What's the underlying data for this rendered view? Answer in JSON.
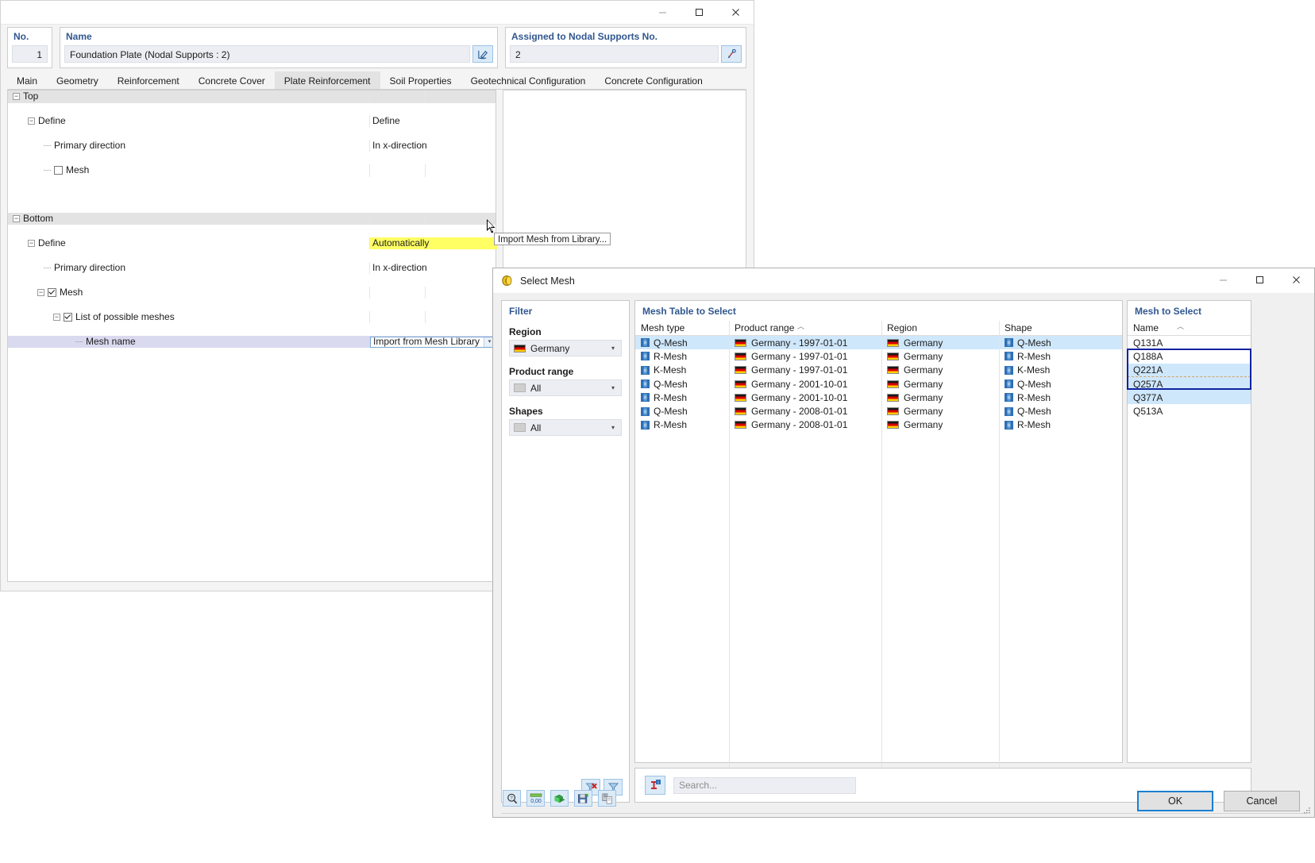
{
  "main_window": {
    "title_controls": [
      "minimize",
      "maximize",
      "close"
    ],
    "fields": {
      "no_label": "No.",
      "no_value": "1",
      "name_label": "Name",
      "name_value": "Foundation Plate (Nodal Supports : 2)",
      "name_edit_icon": "edit-pencil-icon",
      "assigned_label": "Assigned to Nodal Supports No.",
      "assigned_value": "2",
      "assigned_pick_icon": "pick-object-icon"
    },
    "tabs": [
      {
        "label": "Main",
        "active": false
      },
      {
        "label": "Geometry",
        "active": false
      },
      {
        "label": "Reinforcement",
        "active": false
      },
      {
        "label": "Concrete Cover",
        "active": false
      },
      {
        "label": "Plate Reinforcement",
        "active": true
      },
      {
        "label": "Soil Properties",
        "active": false
      },
      {
        "label": "Geotechnical Configuration",
        "active": false
      },
      {
        "label": "Concrete Configuration",
        "active": false
      }
    ],
    "tree": {
      "top_group": "Top",
      "top_define_label": "Define",
      "top_define_value": "Define",
      "top_primary_label": "Primary direction",
      "top_primary_value": "In x-direction",
      "top_mesh_label": "Mesh",
      "bottom_group": "Bottom",
      "bottom_define_label": "Define",
      "bottom_define_value": "Automatically",
      "bottom_primary_label": "Primary direction",
      "bottom_primary_value": "In x-direction",
      "bottom_mesh_label": "Mesh",
      "list_meshes_label": "List of possible meshes",
      "mesh_name_label": "Mesh name",
      "mesh_name_value": "Import from Mesh Library"
    },
    "tooltip": "Import Mesh from Library..."
  },
  "dialog": {
    "title": "Select Mesh",
    "icon": "mesh-library-icon",
    "title_controls": [
      "minimize",
      "maximize",
      "close"
    ],
    "filter": {
      "title": "Filter",
      "region_label": "Region",
      "region_value": "Germany",
      "region_icon": "germany-flag-icon",
      "product_range_label": "Product range",
      "product_range_value": "All",
      "shapes_label": "Shapes",
      "shapes_value": "All",
      "clear_filter_icon": "clear-filter-icon",
      "apply_filter_icon": "filter-icon"
    },
    "mesh_table": {
      "title": "Mesh Table to Select",
      "columns": [
        "Mesh type",
        "Product range",
        "Region",
        "Shape"
      ],
      "sorted_column": "Product range",
      "sort_direction": "ascending",
      "rows": [
        {
          "mesh_type": "Q-Mesh",
          "product_range": "Germany - 1997-01-01",
          "region": "Germany",
          "shape": "Q-Mesh",
          "selected": true
        },
        {
          "mesh_type": "R-Mesh",
          "product_range": "Germany - 1997-01-01",
          "region": "Germany",
          "shape": "R-Mesh",
          "selected": false
        },
        {
          "mesh_type": "K-Mesh",
          "product_range": "Germany - 1997-01-01",
          "region": "Germany",
          "shape": "K-Mesh",
          "selected": false
        },
        {
          "mesh_type": "Q-Mesh",
          "product_range": "Germany - 2001-10-01",
          "region": "Germany",
          "shape": "Q-Mesh",
          "selected": false
        },
        {
          "mesh_type": "R-Mesh",
          "product_range": "Germany - 2001-10-01",
          "region": "Germany",
          "shape": "R-Mesh",
          "selected": false
        },
        {
          "mesh_type": "Q-Mesh",
          "product_range": "Germany - 2008-01-01",
          "region": "Germany",
          "shape": "Q-Mesh",
          "selected": false
        },
        {
          "mesh_type": "R-Mesh",
          "product_range": "Germany - 2008-01-01",
          "region": "Germany",
          "shape": "R-Mesh",
          "selected": false
        }
      ]
    },
    "mesh_to_select": {
      "title": "Mesh to Select",
      "column": "Name",
      "sort_direction": "ascending",
      "rows": [
        {
          "name": "Q131A",
          "selected": false
        },
        {
          "name": "Q188A",
          "selected": false
        },
        {
          "name": "Q221A",
          "selected": true
        },
        {
          "name": "Q257A",
          "selected": true
        },
        {
          "name": "Q377A",
          "selected": true
        },
        {
          "name": "Q513A",
          "selected": false
        }
      ]
    },
    "search": {
      "icon": "info-object-icon",
      "placeholder": "Search..."
    },
    "toolbar_icons": [
      "help-magnifier-icon",
      "number-format-icon",
      "export-icon",
      "save-icon",
      "copy-icon"
    ],
    "buttons": {
      "ok": "OK",
      "cancel": "Cancel"
    }
  }
}
